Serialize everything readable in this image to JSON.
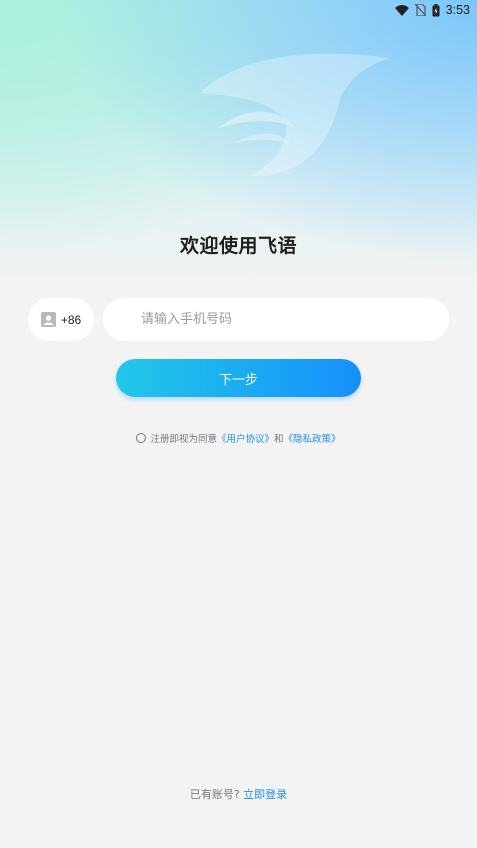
{
  "status_bar": {
    "time": "3:53",
    "icons": [
      "wifi-icon",
      "no-sim-icon",
      "battery-icon"
    ]
  },
  "welcome": {
    "title": "欢迎使用飞语"
  },
  "login_form": {
    "country_code": "+86",
    "phone_placeholder": "请输入手机号码",
    "phone_value": "",
    "next_label": "下一步"
  },
  "agreement": {
    "prefix": "注册即视为同意",
    "user_agreement": "《用户协议》",
    "and": "和",
    "privacy_policy": "《隐私政策》",
    "checked": false
  },
  "footer": {
    "prompt": "已有账号?",
    "login_link": "立即登录"
  },
  "colors": {
    "accent": "#1e8fe8",
    "button_gradient_start": "#21c8e8",
    "button_gradient_end": "#1690fb",
    "background": "#f3f3f3"
  }
}
